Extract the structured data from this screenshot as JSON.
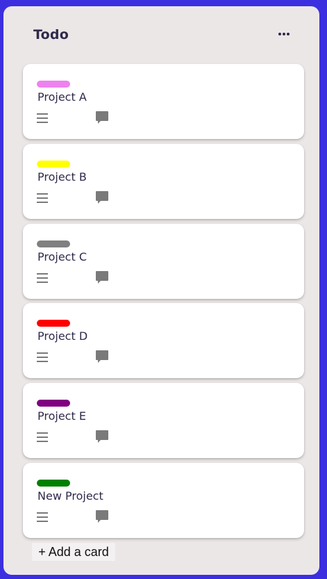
{
  "list": {
    "title": "Todo",
    "menu_icon": "more-horizontal-icon"
  },
  "cards": [
    {
      "title": "Project A",
      "label_color": "#ee82ee"
    },
    {
      "title": "Project B",
      "label_color": "#ffff00"
    },
    {
      "title": "Project C",
      "label_color": "#808080"
    },
    {
      "title": "Project D",
      "label_color": "#ff0000"
    },
    {
      "title": "Project E",
      "label_color": "#800080"
    },
    {
      "title": "New Project",
      "label_color": "#008000"
    }
  ],
  "card_icons": {
    "description": "description-lines-icon",
    "comment": "comment-icon"
  },
  "add_card_label": "+ Add a card",
  "colors": {
    "background": "#3b2fe0",
    "list_background": "#ece7e7",
    "card_background": "#ffffff",
    "text": "#2f2a4a",
    "icon": "#7a7a7a"
  }
}
